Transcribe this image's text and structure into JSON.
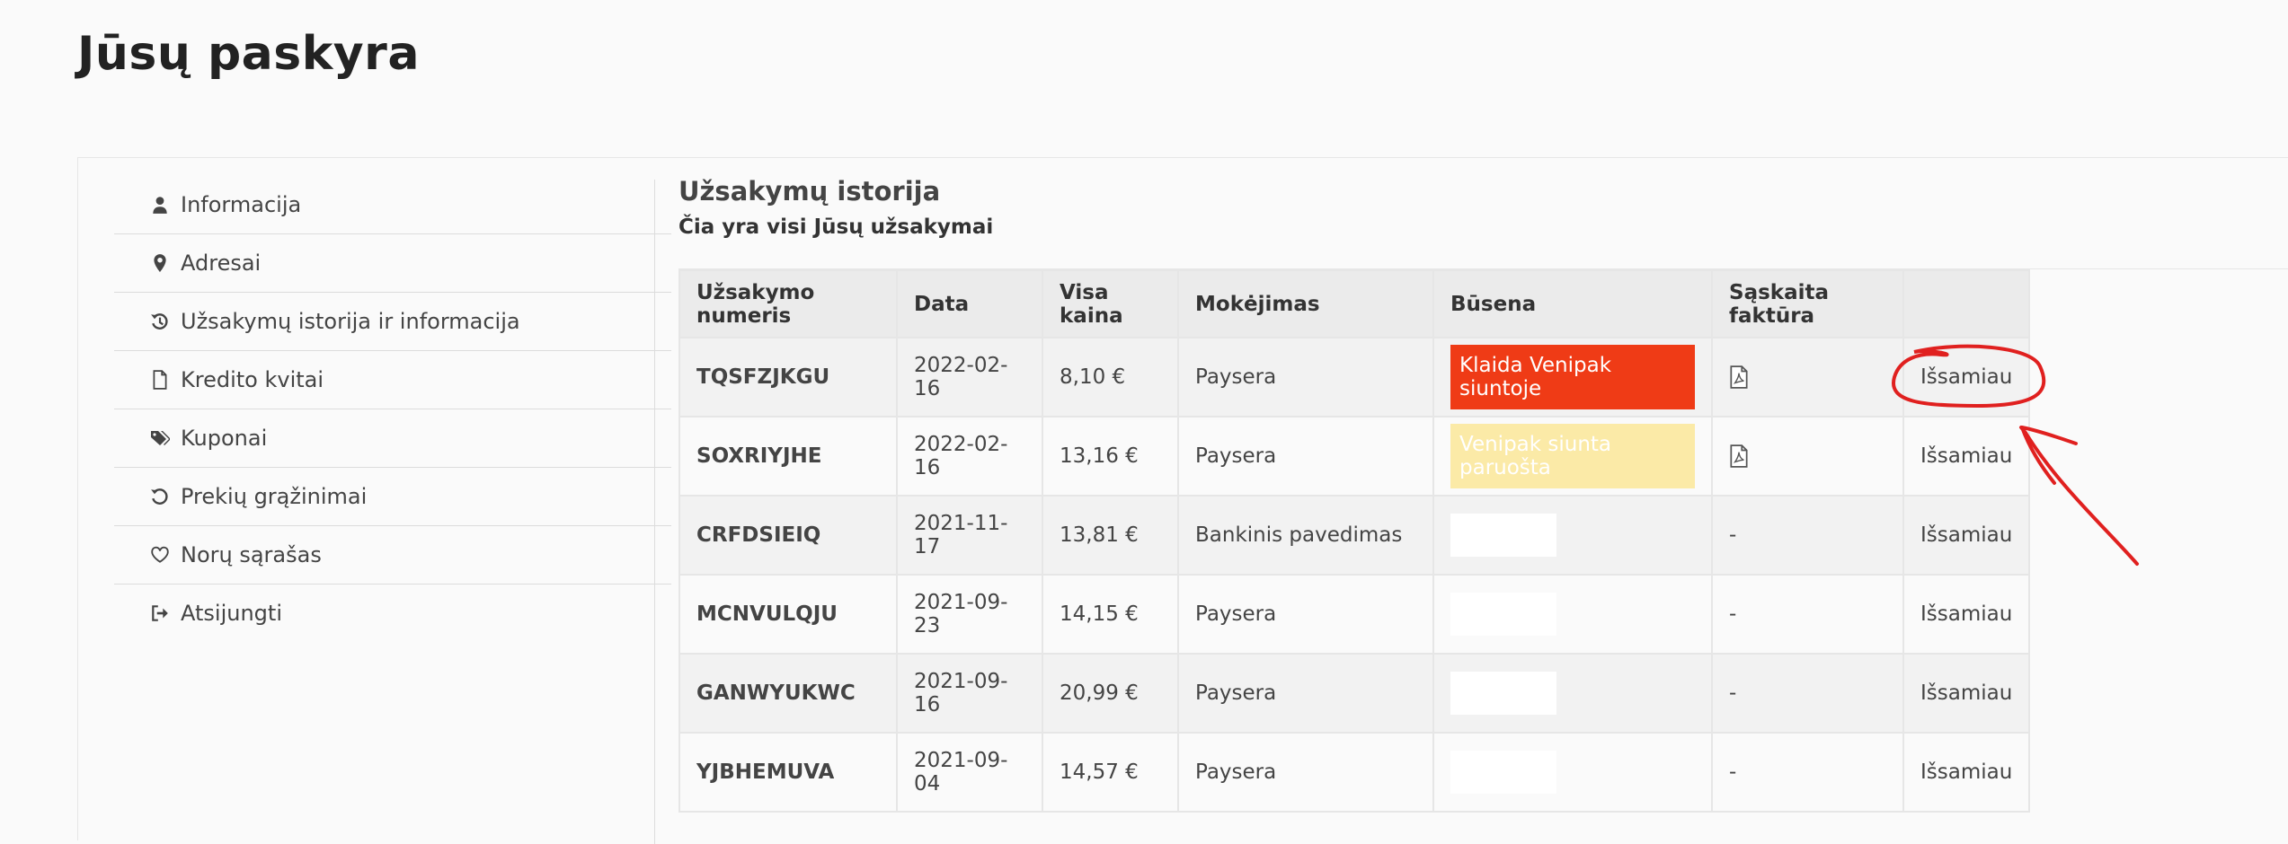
{
  "page": {
    "title": "Jūsų paskyra"
  },
  "sidebar": {
    "items": [
      {
        "label": "Informacija",
        "icon": "user-icon"
      },
      {
        "label": "Adresai",
        "icon": "map-pin-icon"
      },
      {
        "label": "Užsakymų istorija ir informacija",
        "icon": "history-icon"
      },
      {
        "label": "Kredito kvitai",
        "icon": "document-icon"
      },
      {
        "label": "Kuponai",
        "icon": "tags-icon"
      },
      {
        "label": "Prekių grąžinimai",
        "icon": "return-icon"
      },
      {
        "label": "Norų sąrašas",
        "icon": "heart-icon"
      },
      {
        "label": "Atsijungti",
        "icon": "sign-out-icon"
      }
    ]
  },
  "orders": {
    "title": "Užsakymų istorija",
    "subtitle": "Čia yra visi Jūsų užsakymai",
    "columns": [
      "Užsakymo numeris",
      "Data",
      "Visa kaina",
      "Mokėjimas",
      "Būsena",
      "Sąskaita faktūra",
      ""
    ],
    "rows": [
      {
        "number": "TQSFZJKGU",
        "date": "2022-02-16",
        "total": "8,10 €",
        "payment": "Paysera",
        "status": "Klaida Venipak siuntoje",
        "status_type": "error",
        "invoice": "pdf",
        "details": "Išsamiau"
      },
      {
        "number": "SOXRIYJHE",
        "date": "2022-02-16",
        "total": "13,16 €",
        "payment": "Paysera",
        "status": "Venipak siunta paruošta",
        "status_type": "ready",
        "invoice": "pdf",
        "details": "Išsamiau"
      },
      {
        "number": "CRFDSIEIQ",
        "date": "2021-11-17",
        "total": "13,81 €",
        "payment": "Bankinis pavedimas",
        "status": "",
        "status_type": "empty",
        "invoice": "-",
        "details": "Išsamiau"
      },
      {
        "number": "MCNVULQJU",
        "date": "2021-09-23",
        "total": "14,15 €",
        "payment": "Paysera",
        "status": "",
        "status_type": "empty",
        "invoice": "-",
        "details": "Išsamiau"
      },
      {
        "number": "GANWYUKWC",
        "date": "2021-09-16",
        "total": "20,99 €",
        "payment": "Paysera",
        "status": "",
        "status_type": "empty",
        "invoice": "-",
        "details": "Išsamiau"
      },
      {
        "number": "YJBHEMUVA",
        "date": "2021-09-04",
        "total": "14,57 €",
        "payment": "Paysera",
        "status": "",
        "status_type": "empty",
        "invoice": "-",
        "details": "Išsamiau"
      }
    ]
  },
  "colors": {
    "error_badge": "#ef3b16",
    "ready_badge": "#fbeaa7",
    "annotation": "#e0201f"
  }
}
